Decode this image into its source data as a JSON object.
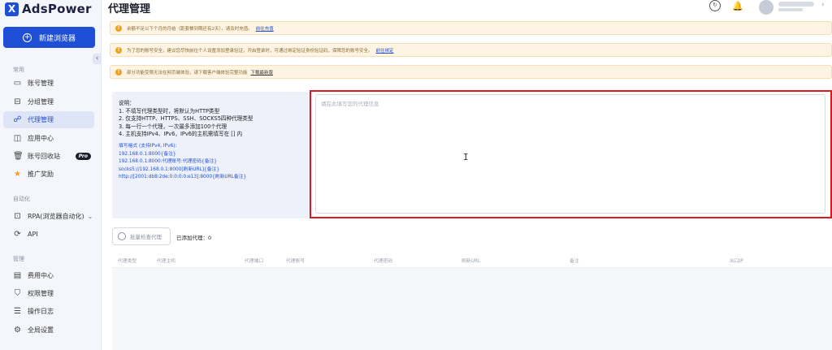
{
  "app": {
    "logo_text": "AdsPower",
    "logo_mark": "X"
  },
  "sidebar": {
    "new_browser_label": "新建浏览器",
    "collapse_icon": "‹",
    "section_common": "常用",
    "section_automation": "自动化",
    "section_manage": "管理",
    "items": [
      {
        "label": "账号管理",
        "icon": "folder-icon"
      },
      {
        "label": "分组管理",
        "icon": "group-folder-icon"
      },
      {
        "label": "代理管理",
        "icon": "proxy-icon",
        "active": true
      },
      {
        "label": "应用中心",
        "icon": "app-icon"
      },
      {
        "label": "账号回收站",
        "icon": "trash-icon",
        "badge": "Pro"
      },
      {
        "label": "推广奖励",
        "icon": "star-icon"
      },
      {
        "label": "RPA(浏览器自动化)",
        "icon": "rpa-icon"
      },
      {
        "label": "API",
        "icon": "api-icon"
      },
      {
        "label": "费用中心",
        "icon": "billing-icon"
      },
      {
        "label": "权限管理",
        "icon": "shield-icon"
      },
      {
        "label": "操作日志",
        "icon": "log-icon"
      },
      {
        "label": "全局设置",
        "icon": "settings-icon"
      }
    ]
  },
  "header": {
    "title": "代理管理"
  },
  "notices": [
    {
      "text": "余额不足以下个月的月结（距套餐到期还有2天），请及时充值。",
      "link": "前往充值"
    },
    {
      "text": "为了您的账号安全，建议您尽快前往个人设置添加登录验证，开启登录时，可通过绑定验证身份验证码，保障您的账号安全。",
      "link": "前往绑定"
    },
    {
      "text": "部分功能受限无法在网页端体验，请下载客户端体验完整功能",
      "link": "下载最新版"
    }
  ],
  "instructions": {
    "title": "说明：",
    "lines": [
      "1. 不填写代理类型时，将默认为HTTP类型",
      "2. 仅支持HTTP、HTTPS、SSH、SOCKS5四种代理类型",
      "3. 每一行一个代理，一次最多添加100个代理",
      "4. 主机支持IPv4、IPv6，IPv6的主机需填写在 [] 内"
    ],
    "format_title": "填写格式 (支持IPv4, IPv6):",
    "examples": [
      "192.168.0.1:8000{备注}",
      "192.168.0.1:8000:代理账号:代理密码{备注}",
      "socks5://192.168.0.1:8000[刷新URL]{备注}",
      "http://[2001:db8:2de:0:0:0:0:e13]:8000{刷新URL备注}"
    ]
  },
  "proxy_input": {
    "placeholder": "请在此填写您的代理信息",
    "value": ""
  },
  "batch_check_label": "批量检查代理",
  "added_count_text": "已添加代理：0",
  "table_columns": [
    "代理类型",
    "代理主机",
    "代理端口",
    "代理账号",
    "代理密码",
    "刷新URL",
    "备注",
    "出口IP"
  ]
}
